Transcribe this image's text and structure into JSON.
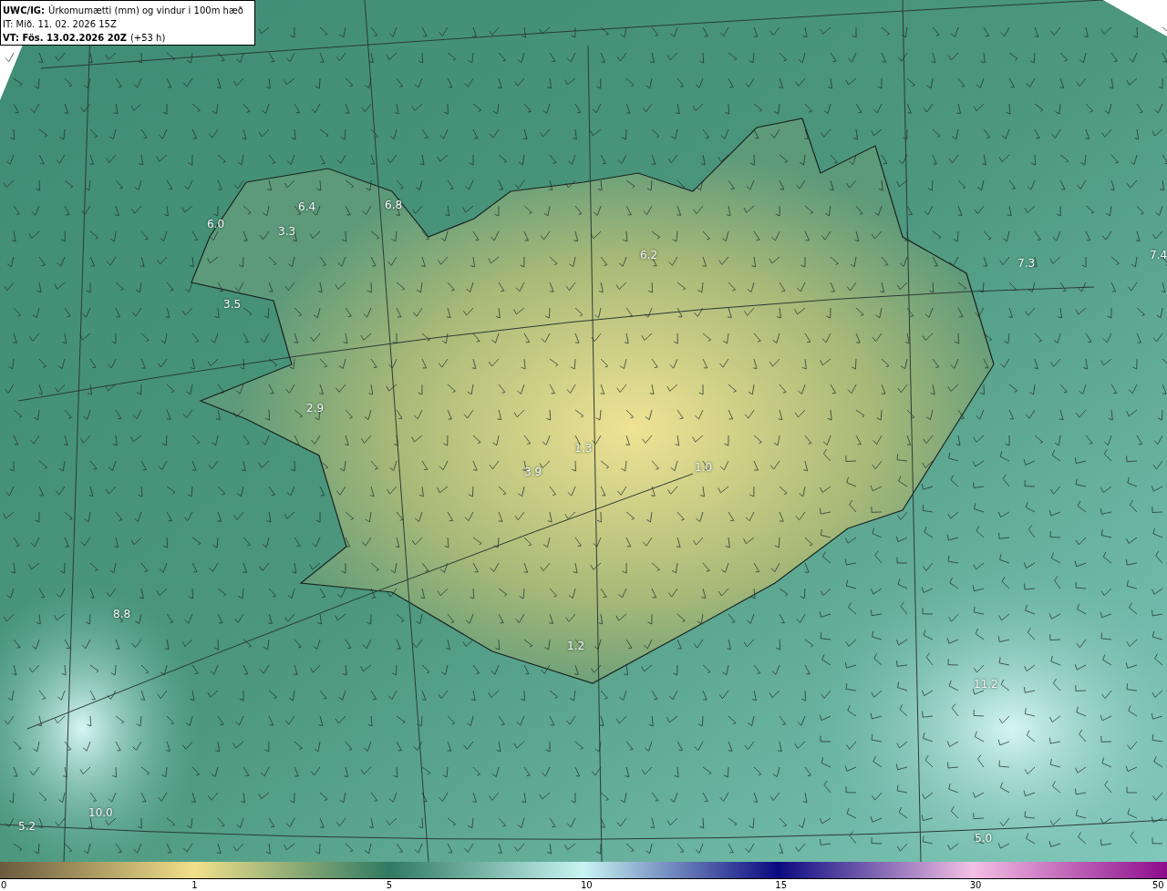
{
  "header": {
    "model": "UWC/IG:",
    "title": "Úrkomumætti (mm) og vindur i 100m hæð",
    "init": "IT: Mið. 11. 02. 2026 15Z",
    "valid": "VT: Fös. 13.02.2026 20Z",
    "offset": "(+53 h)"
  },
  "map_labels": [
    "6.4",
    "6.8",
    "6.0",
    "3.3",
    "3.5",
    "6.2",
    "7.3",
    "7.4",
    "2.9",
    "3.9",
    "1.3",
    "1.0",
    "1.2",
    "8.8",
    "11.2",
    "10.0",
    "5.2",
    "5.0"
  ],
  "colorbar": {
    "ticks": [
      "0",
      "1",
      "5",
      "10",
      "15",
      "30",
      "50"
    ]
  }
}
